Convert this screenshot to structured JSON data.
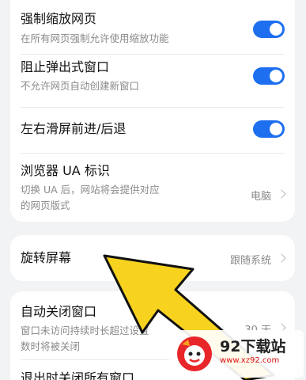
{
  "card1": {
    "force_zoom": {
      "title": "强制缩放网页",
      "subtitle": "在所有网页强制允许使用缩放功能",
      "enabled": true
    },
    "block_popups": {
      "title": "阻止弹出式窗口",
      "subtitle": "不允许网页自动创建新窗口",
      "enabled": true
    },
    "swipe_nav": {
      "title": "左右滑屏前进/后退",
      "enabled": true
    },
    "browser_ua": {
      "title": "浏览器 UA 标识",
      "subtitle_line1": "切换 UA 后，网站将会提供对应",
      "subtitle_line2": "的网页版式",
      "value": "电脑"
    }
  },
  "card2": {
    "rotate_screen": {
      "title": "旋转屏幕",
      "value": "跟随系统"
    }
  },
  "card3": {
    "auto_close": {
      "title": "自动关闭窗口",
      "subtitle_line1": "窗口未访问持续时长超过设置",
      "subtitle_line2": "数时将被关闭",
      "value": "30 天"
    },
    "exit_close": {
      "title": "退出时关闭所有窗口"
    }
  },
  "watermark": {
    "name": "92下载站",
    "url": "www.xz92.com"
  },
  "colors": {
    "accent": "#1e6ff0",
    "arrow": "#f7d21f",
    "background": "#f1f3f5"
  }
}
